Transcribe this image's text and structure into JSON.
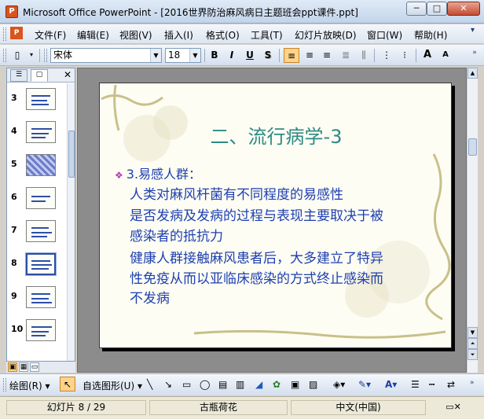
{
  "window": {
    "title": "Microsoft Office PowerPoint - [2016世界防治麻风病日主题班会ppt课件.ppt]",
    "app_icon_glyph": "P",
    "min_glyph": "─",
    "max_glyph": "□",
    "close_glyph": "✕"
  },
  "menu": {
    "items": [
      "文件(F)",
      "编辑(E)",
      "视图(V)",
      "插入(I)",
      "格式(O)",
      "工具(T)",
      "幻灯片放映(D)",
      "窗口(W)",
      "帮助(H)"
    ]
  },
  "format_toolbar": {
    "font_name": "宋体",
    "font_size": "18",
    "bold": "B",
    "italic": "I",
    "underline": "U",
    "shadow": "S",
    "grow_font": "A",
    "shrink_font": "A"
  },
  "left_panel": {
    "tab_outline": "☰",
    "tab_slides": "▢",
    "close": "✕",
    "thumbnails": [
      {
        "number": "3"
      },
      {
        "number": "4"
      },
      {
        "number": "5"
      },
      {
        "number": "6"
      },
      {
        "number": "7"
      },
      {
        "number": "8"
      },
      {
        "number": "9"
      },
      {
        "number": "10"
      }
    ],
    "selected": "8"
  },
  "slide": {
    "title": "二、流行病学-3",
    "bullet": "3.易感人群：",
    "bullet_mark": "❖",
    "lines": [
      "人类对麻风杆菌有不同程度的易感性",
      "是否发病及发病的过程与表现主要取决于被",
      "感染者的抵抗力",
      "健康人群接触麻风患者后，大多建立了特异",
      "性免疫从而以亚临床感染的方式终止感染而",
      "不发病"
    ]
  },
  "drawing_toolbar": {
    "draw_label": "绘图(R)",
    "autoshapes_label": "自选图形(U)"
  },
  "status": {
    "slide_info": "幻灯片 8 / 29",
    "design": "古瓶荷花",
    "language": "中文(中国)"
  },
  "colors": {
    "title": "#2e8a84",
    "body_text": "#1e3fb0",
    "vine": "#c9c08a"
  }
}
